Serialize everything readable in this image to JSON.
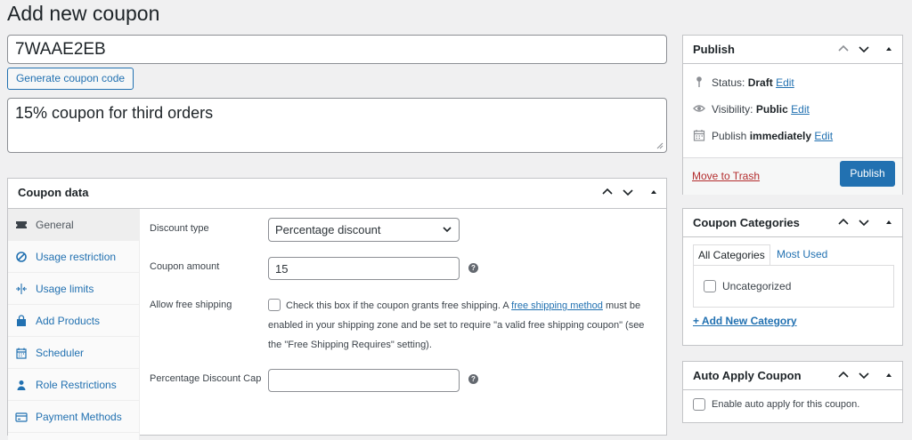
{
  "page": {
    "title": "Add new coupon"
  },
  "coupon": {
    "code": "7WAAE2EB",
    "generate_label": "Generate coupon code",
    "description": "15% coupon for third orders"
  },
  "coupon_data": {
    "title": "Coupon data",
    "tabs": [
      {
        "label": "General",
        "icon": "ticket-icon"
      },
      {
        "label": "Usage restriction",
        "icon": "restriction-icon"
      },
      {
        "label": "Usage limits",
        "icon": "limits-icon"
      },
      {
        "label": "Add Products",
        "icon": "bag-icon"
      },
      {
        "label": "Scheduler",
        "icon": "calendar-icon"
      },
      {
        "label": "Role Restrictions",
        "icon": "user-icon"
      },
      {
        "label": "Payment Methods",
        "icon": "card-icon"
      }
    ],
    "fields": {
      "discount_type_label": "Discount type",
      "discount_type_value": "Percentage discount",
      "amount_label": "Coupon amount",
      "amount_value": "15",
      "free_shipping_label": "Allow free shipping",
      "free_shipping_text_before": "Check this box if the coupon grants free shipping. A ",
      "free_shipping_link": "free shipping method",
      "free_shipping_text_after": " must be enabled in your shipping zone and be set to require \"a valid free shipping coupon\" (see the \"Free Shipping Requires\" setting).",
      "cap_label": "Percentage Discount Cap",
      "cap_value": ""
    }
  },
  "publish": {
    "title": "Publish",
    "status_label": "Status:",
    "status_value": "Draft",
    "visibility_label": "Visibility:",
    "visibility_value": "Public",
    "publish_label": "Publish",
    "publish_value": "immediately",
    "edit": "Edit",
    "trash": "Move to Trash",
    "button": "Publish"
  },
  "categories": {
    "title": "Coupon Categories",
    "tab_all": "All Categories",
    "tab_used": "Most Used",
    "items": [
      "Uncategorized"
    ],
    "add_new": "+ Add New Category"
  },
  "auto_apply": {
    "title": "Auto Apply Coupon",
    "checkbox_label": "Enable auto apply for this coupon."
  },
  "colors": {
    "accent": "#2271b1",
    "danger": "#b32d2e",
    "background": "#f0f0f1"
  }
}
